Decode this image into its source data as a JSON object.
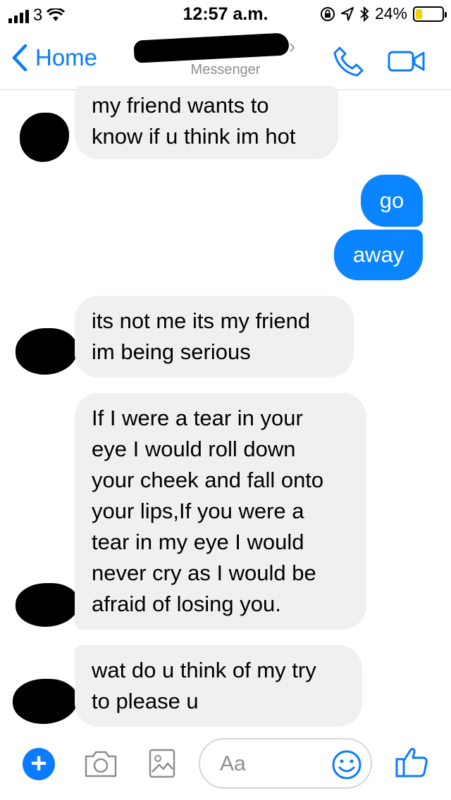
{
  "status_bar": {
    "carrier": "3",
    "time": "12:57 a.m.",
    "battery_percent": "24%",
    "battery_level": 0.24,
    "icons": [
      "signal-icon",
      "wifi-icon",
      "lock-rotation-icon",
      "location-icon",
      "bluetooth-icon",
      "battery-icon"
    ]
  },
  "nav": {
    "back_label": "Home",
    "subtitle": "Messenger",
    "icons": [
      "back-chevron-icon",
      "phone-icon",
      "video-icon"
    ]
  },
  "messages": [
    {
      "direction": "incoming",
      "lines": [
        "my friend wants to",
        "know if u think im hot"
      ]
    },
    {
      "direction": "outgoing",
      "lines": [
        "go"
      ]
    },
    {
      "direction": "outgoing",
      "lines": [
        "away"
      ]
    },
    {
      "direction": "incoming",
      "lines": [
        "its not me its my friend",
        "im being serious"
      ]
    },
    {
      "direction": "incoming",
      "lines": [
        "If I were a tear in your",
        "eye I would roll down",
        "your cheek and fall onto",
        "your lips,If you were a",
        "tear in my eye I would",
        "never cry as I would be",
        "afraid of losing you."
      ]
    },
    {
      "direction": "incoming",
      "lines": [
        "wat do u think of my try",
        "to please u"
      ]
    }
  ],
  "composer": {
    "placeholder": "Aa",
    "icons": [
      "plus-icon",
      "camera-icon",
      "image-icon",
      "emoji-icon",
      "thumbs-up-icon"
    ]
  },
  "colors": {
    "accent": "#0a7cff",
    "outgoing_bubble": "#0a84ff",
    "incoming_bubble": "#f1f0f0"
  }
}
